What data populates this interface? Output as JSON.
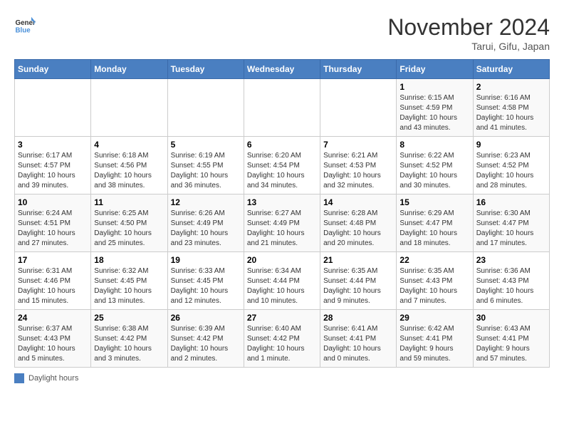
{
  "logo": {
    "line1": "General",
    "line2": "Blue"
  },
  "title": "November 2024",
  "subtitle": "Tarui, Gifu, Japan",
  "days_of_week": [
    "Sunday",
    "Monday",
    "Tuesday",
    "Wednesday",
    "Thursday",
    "Friday",
    "Saturday"
  ],
  "weeks": [
    [
      {
        "day": "",
        "info": ""
      },
      {
        "day": "",
        "info": ""
      },
      {
        "day": "",
        "info": ""
      },
      {
        "day": "",
        "info": ""
      },
      {
        "day": "",
        "info": ""
      },
      {
        "day": "1",
        "info": "Sunrise: 6:15 AM\nSunset: 4:59 PM\nDaylight: 10 hours\nand 43 minutes."
      },
      {
        "day": "2",
        "info": "Sunrise: 6:16 AM\nSunset: 4:58 PM\nDaylight: 10 hours\nand 41 minutes."
      }
    ],
    [
      {
        "day": "3",
        "info": "Sunrise: 6:17 AM\nSunset: 4:57 PM\nDaylight: 10 hours\nand 39 minutes."
      },
      {
        "day": "4",
        "info": "Sunrise: 6:18 AM\nSunset: 4:56 PM\nDaylight: 10 hours\nand 38 minutes."
      },
      {
        "day": "5",
        "info": "Sunrise: 6:19 AM\nSunset: 4:55 PM\nDaylight: 10 hours\nand 36 minutes."
      },
      {
        "day": "6",
        "info": "Sunrise: 6:20 AM\nSunset: 4:54 PM\nDaylight: 10 hours\nand 34 minutes."
      },
      {
        "day": "7",
        "info": "Sunrise: 6:21 AM\nSunset: 4:53 PM\nDaylight: 10 hours\nand 32 minutes."
      },
      {
        "day": "8",
        "info": "Sunrise: 6:22 AM\nSunset: 4:52 PM\nDaylight: 10 hours\nand 30 minutes."
      },
      {
        "day": "9",
        "info": "Sunrise: 6:23 AM\nSunset: 4:52 PM\nDaylight: 10 hours\nand 28 minutes."
      }
    ],
    [
      {
        "day": "10",
        "info": "Sunrise: 6:24 AM\nSunset: 4:51 PM\nDaylight: 10 hours\nand 27 minutes."
      },
      {
        "day": "11",
        "info": "Sunrise: 6:25 AM\nSunset: 4:50 PM\nDaylight: 10 hours\nand 25 minutes."
      },
      {
        "day": "12",
        "info": "Sunrise: 6:26 AM\nSunset: 4:49 PM\nDaylight: 10 hours\nand 23 minutes."
      },
      {
        "day": "13",
        "info": "Sunrise: 6:27 AM\nSunset: 4:49 PM\nDaylight: 10 hours\nand 21 minutes."
      },
      {
        "day": "14",
        "info": "Sunrise: 6:28 AM\nSunset: 4:48 PM\nDaylight: 10 hours\nand 20 minutes."
      },
      {
        "day": "15",
        "info": "Sunrise: 6:29 AM\nSunset: 4:47 PM\nDaylight: 10 hours\nand 18 minutes."
      },
      {
        "day": "16",
        "info": "Sunrise: 6:30 AM\nSunset: 4:47 PM\nDaylight: 10 hours\nand 17 minutes."
      }
    ],
    [
      {
        "day": "17",
        "info": "Sunrise: 6:31 AM\nSunset: 4:46 PM\nDaylight: 10 hours\nand 15 minutes."
      },
      {
        "day": "18",
        "info": "Sunrise: 6:32 AM\nSunset: 4:45 PM\nDaylight: 10 hours\nand 13 minutes."
      },
      {
        "day": "19",
        "info": "Sunrise: 6:33 AM\nSunset: 4:45 PM\nDaylight: 10 hours\nand 12 minutes."
      },
      {
        "day": "20",
        "info": "Sunrise: 6:34 AM\nSunset: 4:44 PM\nDaylight: 10 hours\nand 10 minutes."
      },
      {
        "day": "21",
        "info": "Sunrise: 6:35 AM\nSunset: 4:44 PM\nDaylight: 10 hours\nand 9 minutes."
      },
      {
        "day": "22",
        "info": "Sunrise: 6:35 AM\nSunset: 4:43 PM\nDaylight: 10 hours\nand 7 minutes."
      },
      {
        "day": "23",
        "info": "Sunrise: 6:36 AM\nSunset: 4:43 PM\nDaylight: 10 hours\nand 6 minutes."
      }
    ],
    [
      {
        "day": "24",
        "info": "Sunrise: 6:37 AM\nSunset: 4:43 PM\nDaylight: 10 hours\nand 5 minutes."
      },
      {
        "day": "25",
        "info": "Sunrise: 6:38 AM\nSunset: 4:42 PM\nDaylight: 10 hours\nand 3 minutes."
      },
      {
        "day": "26",
        "info": "Sunrise: 6:39 AM\nSunset: 4:42 PM\nDaylight: 10 hours\nand 2 minutes."
      },
      {
        "day": "27",
        "info": "Sunrise: 6:40 AM\nSunset: 4:42 PM\nDaylight: 10 hours\nand 1 minute."
      },
      {
        "day": "28",
        "info": "Sunrise: 6:41 AM\nSunset: 4:41 PM\nDaylight: 10 hours\nand 0 minutes."
      },
      {
        "day": "29",
        "info": "Sunrise: 6:42 AM\nSunset: 4:41 PM\nDaylight: 9 hours\nand 59 minutes."
      },
      {
        "day": "30",
        "info": "Sunrise: 6:43 AM\nSunset: 4:41 PM\nDaylight: 9 hours\nand 57 minutes."
      }
    ]
  ],
  "legend": {
    "icon": "legend-box",
    "label": "Daylight hours"
  }
}
